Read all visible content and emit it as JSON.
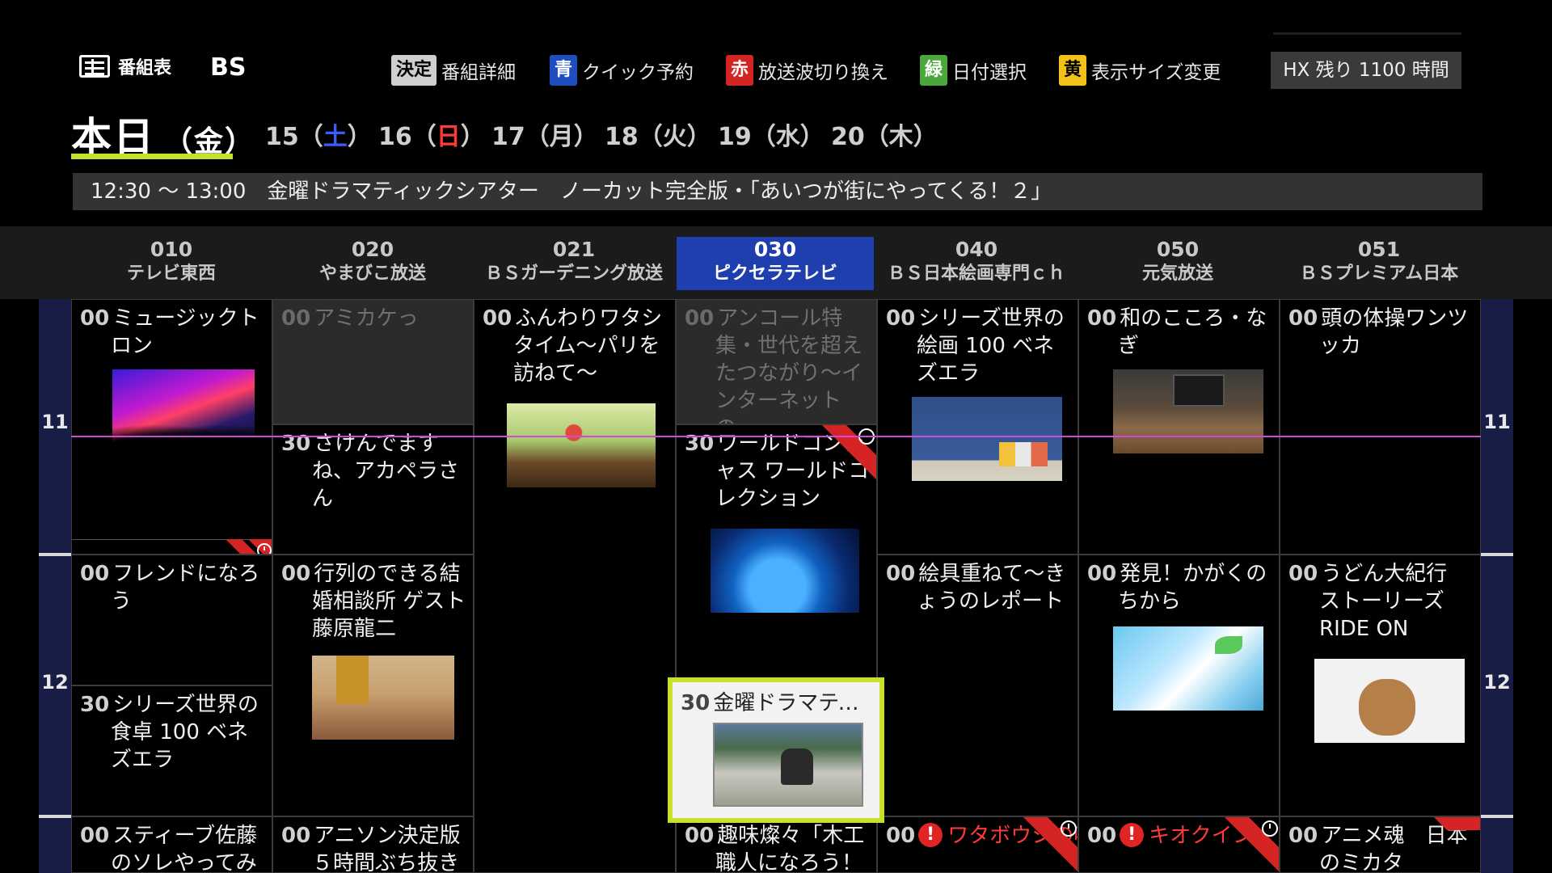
{
  "header": {
    "title": "番組表",
    "band": "BS",
    "band_ghost": "1",
    "hints": [
      {
        "key": "決定",
        "label": "番組詳細",
        "key_bg": "#cfcfcf",
        "key_fg": "#000"
      },
      {
        "key": "青",
        "label": "クイック予約",
        "key_bg": "#1f4fbf",
        "key_fg": "#fff"
      },
      {
        "key": "赤",
        "label": "放送波切り換え",
        "key_bg": "#d42424",
        "key_fg": "#fff"
      },
      {
        "key": "緑",
        "label": "日付選択",
        "key_bg": "#4aa83a",
        "key_fg": "#fff"
      },
      {
        "key": "黄",
        "label": "表示サイズ変更",
        "key_bg": "#f2c21a",
        "key_fg": "#000"
      }
    ],
    "hx_remaining": "HX 残り 1100 時間"
  },
  "dates": {
    "today": "本日",
    "today_dow": "（金）",
    "days": [
      {
        "num": "15",
        "dow": "土",
        "dow_color": "#3a5cff"
      },
      {
        "num": "16",
        "dow": "日",
        "dow_color": "#ff3a3a"
      },
      {
        "num": "17",
        "dow": "月",
        "dow_color": "#cfcfcf"
      },
      {
        "num": "18",
        "dow": "火",
        "dow_color": "#cfcfcf"
      },
      {
        "num": "19",
        "dow": "水",
        "dow_color": "#cfcfcf"
      },
      {
        "num": "20",
        "dow": "木",
        "dow_color": "#cfcfcf"
      }
    ]
  },
  "now_bar": {
    "time": "12:30 ～ 13:00",
    "title": "金曜ドラマティックシアター　ノーカット完全版・「あいつが街にやってくる！２」"
  },
  "channels": [
    {
      "num": "010",
      "name": "テレビ東西"
    },
    {
      "num": "020",
      "name": "やまびこ放送"
    },
    {
      "num": "021",
      "name": "ＢＳガーデニング放送"
    },
    {
      "num": "030",
      "name": "ピクセラテレビ"
    },
    {
      "num": "040",
      "name": "ＢＳ日本絵画専門ｃｈ"
    },
    {
      "num": "050",
      "name": "元気放送"
    },
    {
      "num": "051",
      "name": "ＢＳプレミアム日本"
    }
  ],
  "hours": [
    "11",
    "12"
  ],
  "programs": {
    "c010_a": {
      "min": "00",
      "title": "ミュージックトロン"
    },
    "c010_b": {
      "min": "00",
      "title": "フレンドになろう"
    },
    "c010_c": {
      "min": "30",
      "title": "シリーズ世界の食卓 100 ベネズエラ"
    },
    "c010_d": {
      "min": "00",
      "title": "スティーブ佐藤のソレやってみ"
    },
    "c020_a": {
      "min": "00",
      "title": "アミカケっ"
    },
    "c020_b": {
      "min": "30",
      "title": "さけんでますね、アカペラさん"
    },
    "c020_c": {
      "min": "00",
      "title": "行列のできる結婚相談所 ゲスト 藤原龍二"
    },
    "c020_d": {
      "min": "00",
      "title": "アニソン決定版 ５時間ぶち抜き"
    },
    "c021_a": {
      "min": "00",
      "title": "ふんわりワタシタイム～パリを訪ねて～"
    },
    "c030_a": {
      "min": "00",
      "title": "アンコール特集・世代を超えたつながり～インターネットの…"
    },
    "c030_b": {
      "min": "30",
      "title": "ワールドコンシャス ワールドコレクション"
    },
    "c030_c": {
      "min": "30",
      "title": "金曜ドラマティ…"
    },
    "c030_d": {
      "min": "00",
      "title": "趣味燦々「木工職人になろう！"
    },
    "c040_a": {
      "min": "00",
      "title": "シリーズ世界の絵画 100 ベネズエラ"
    },
    "c040_b": {
      "min": "00",
      "title": "絵具重ねて～きょうのレポート"
    },
    "c040_c": {
      "min": "00",
      "title": "ワタボウシの唄がきこえる"
    },
    "c050_a": {
      "min": "00",
      "title": "和のこころ・なぎ"
    },
    "c050_b": {
      "min": "00",
      "title": "発見！かがくのちから"
    },
    "c050_c": {
      "min": "00",
      "title": "キオクイン"
    },
    "c051_a": {
      "min": "00",
      "title": "頭の体操ワンツッカ"
    },
    "c051_b": {
      "min": "00",
      "title": "うどん大紀行 ストーリーズ RIDE ON"
    },
    "c051_c": {
      "min": "00",
      "title": "アニメ魂　日本のミカタ"
    }
  },
  "icons": {
    "alert": "!"
  },
  "colors": {
    "accent": "#c8e02a",
    "selected_channel": "#1f3fae",
    "now_line": "#d04ad8",
    "hour_col": "#181d45"
  }
}
